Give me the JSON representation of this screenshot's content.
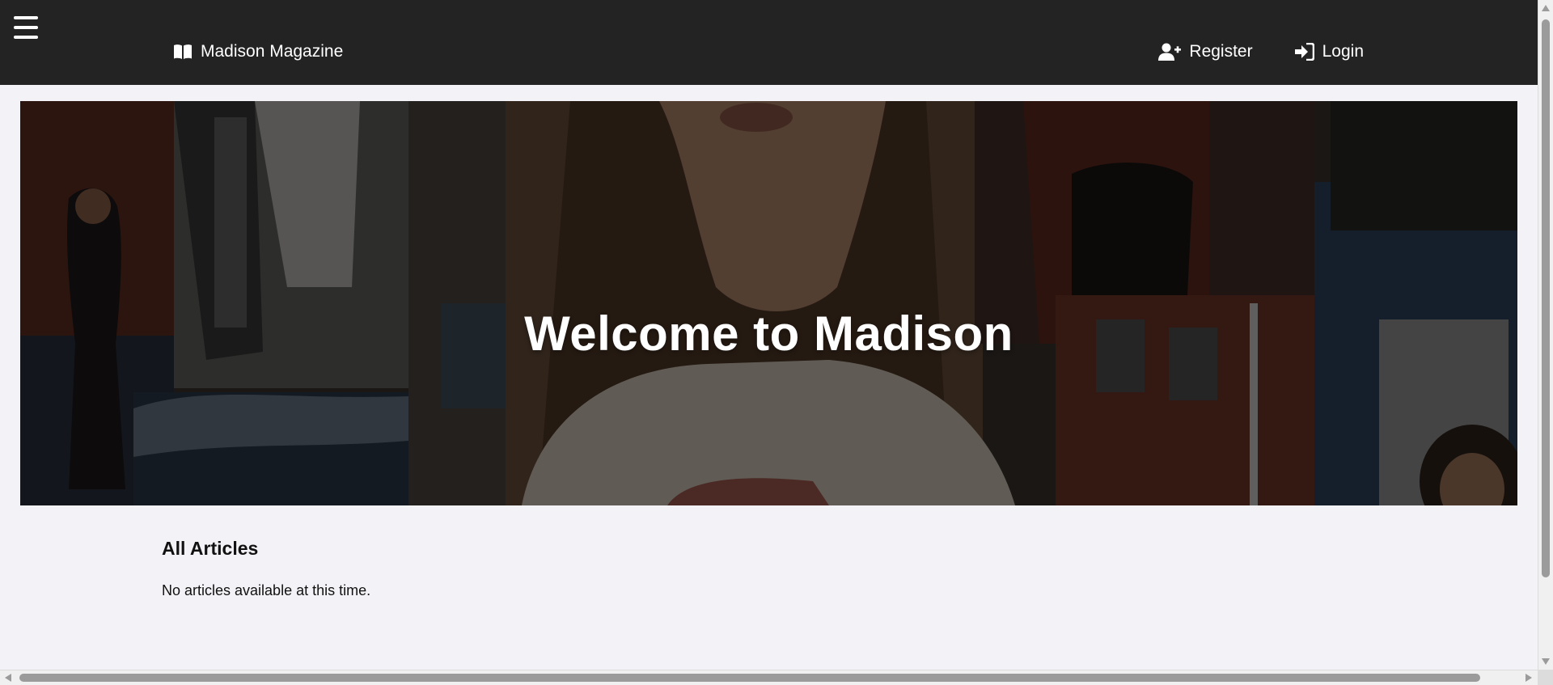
{
  "navbar": {
    "menu_icon": "hamburger-menu-icon",
    "brand_icon": "open-book-icon",
    "brand_label": "Madison Magazine",
    "register_icon": "user-plus-icon",
    "register_label": "Register",
    "login_icon": "sign-in-icon",
    "login_label": "Login",
    "background_color": "#232323"
  },
  "hero": {
    "title": "Welcome to Madison"
  },
  "articles": {
    "heading": "All Articles",
    "empty_message": "No articles available at this time."
  },
  "colors": {
    "page_background": "#f3f3f7",
    "text": "#111111"
  }
}
